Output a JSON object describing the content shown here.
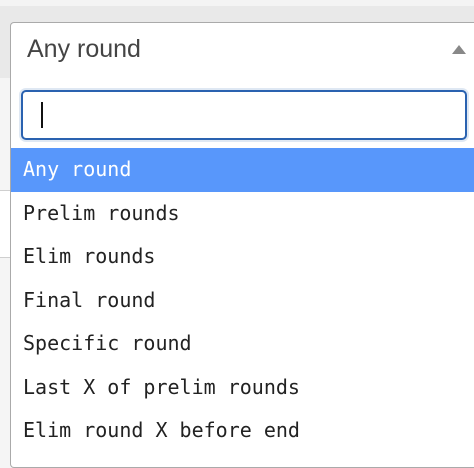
{
  "select": {
    "value": "Any round",
    "arrow_icon": "caret-up-icon"
  },
  "search": {
    "value": "",
    "placeholder": ""
  },
  "options": [
    {
      "label": "Any round",
      "highlighted": true
    },
    {
      "label": "Prelim rounds",
      "highlighted": false
    },
    {
      "label": "Elim rounds",
      "highlighted": false
    },
    {
      "label": "Final round",
      "highlighted": false
    },
    {
      "label": "Specific round",
      "highlighted": false
    },
    {
      "label": "Last X of prelim rounds",
      "highlighted": false
    },
    {
      "label": "Elim round X before end",
      "highlighted": false
    }
  ],
  "colors": {
    "highlight": "#5897fb",
    "focus_border": "#2a62b0",
    "text": "#222222"
  }
}
